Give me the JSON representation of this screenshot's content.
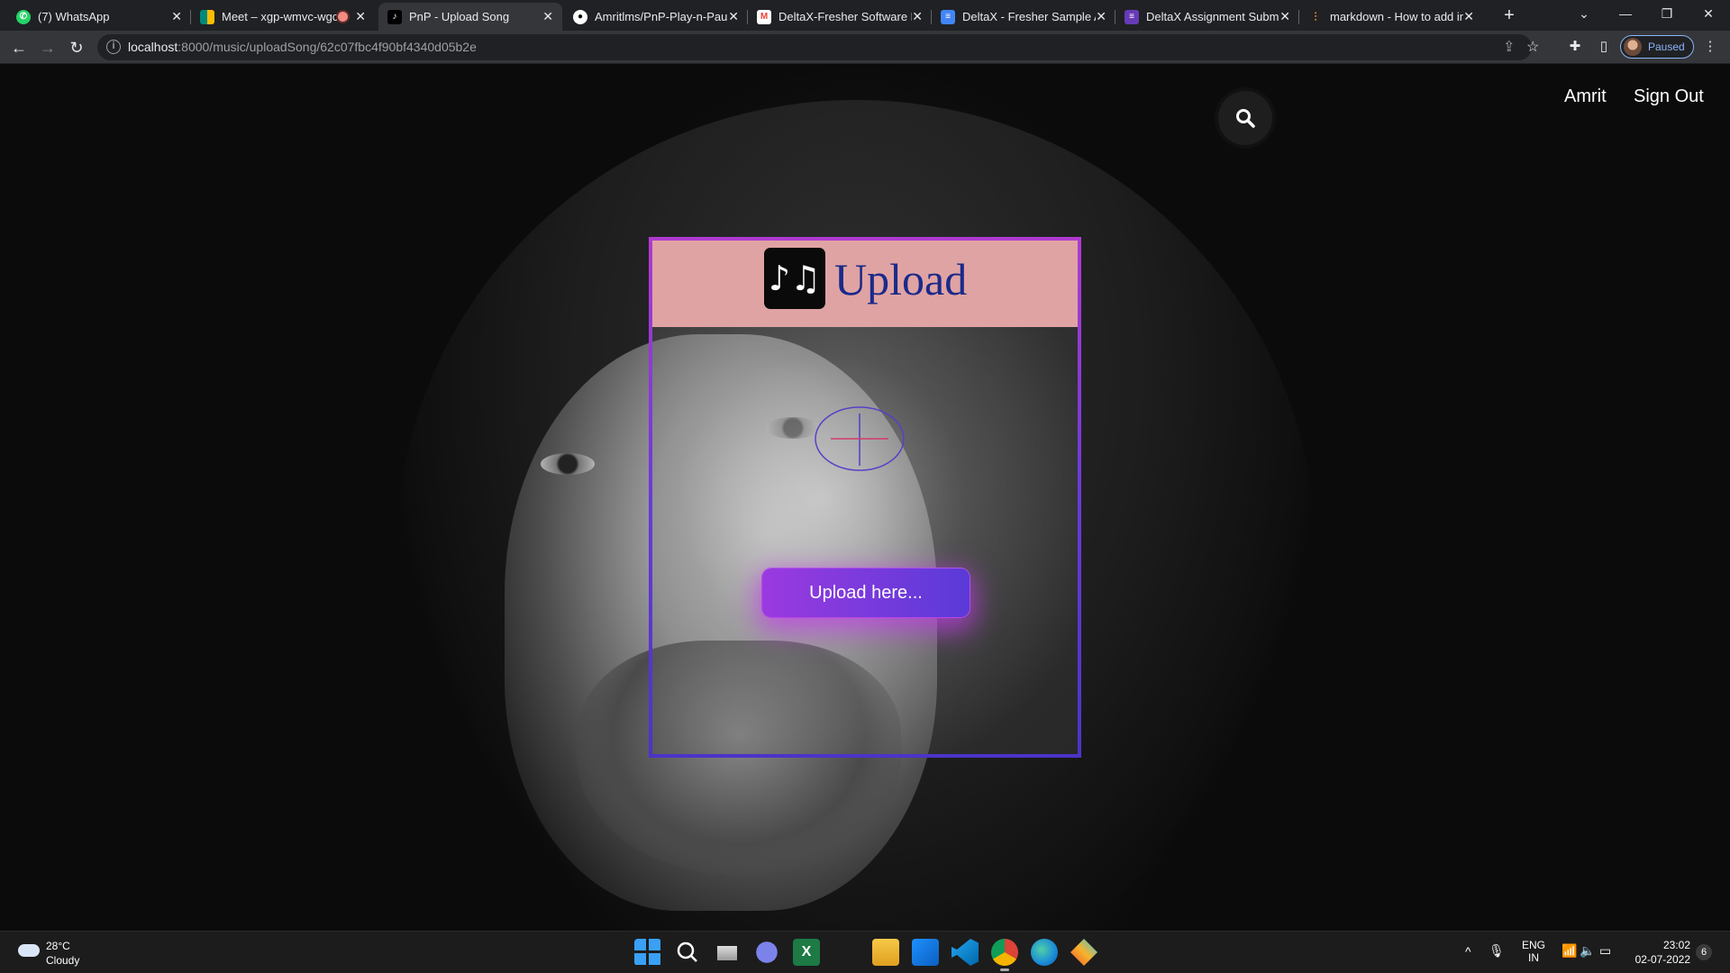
{
  "browser": {
    "tabs": [
      {
        "title": "(7) WhatsApp",
        "icon": "whatsapp-icon",
        "color": "#25d366"
      },
      {
        "title": "Meet – xgp-wmvc-wgc",
        "icon": "google-meet-icon",
        "color": "#00897b"
      },
      {
        "title": "PnP - Upload Song",
        "icon": "pnp-music-icon",
        "color": "#000000"
      },
      {
        "title": "Amritlms/PnP-Play-n-Pause",
        "icon": "github-icon",
        "color": "#ffffff"
      },
      {
        "title": "DeltaX-Fresher Software Engineer",
        "icon": "gmail-icon",
        "color": "#ea4335"
      },
      {
        "title": "DeltaX - Fresher Sample Assignment",
        "icon": "google-docs-icon",
        "color": "#4285f4"
      },
      {
        "title": "DeltaX Assignment Submission",
        "icon": "google-forms-icon",
        "color": "#673ab7"
      },
      {
        "title": "markdown - How to add image",
        "icon": "stackoverflow-icon",
        "color": "#f48024"
      }
    ],
    "active_tab_index": 2,
    "url_host": "localhost",
    "url_path": ":8000/music/uploadSong/62c07fbc4f90bf4340d05b2e",
    "profile_label": "Paused"
  },
  "page": {
    "nav_user": "Amrit",
    "nav_signout": "Sign Out",
    "card_title": "Upload",
    "logo_glyph": "♪♫",
    "upload_button": "Upload here..."
  },
  "taskbar": {
    "weather_temp": "28°C",
    "weather_desc": "Cloudy",
    "lang_top": "ENG",
    "lang_bottom": "IN",
    "time": "23:02",
    "date": "02-07-2022",
    "notification_count": "6"
  },
  "colors": {
    "card_header": "#e0a3a3",
    "card_title": "#1a2a8a",
    "button_gradient_start": "#9a3ae0",
    "button_gradient_end": "#5a3ad8"
  }
}
